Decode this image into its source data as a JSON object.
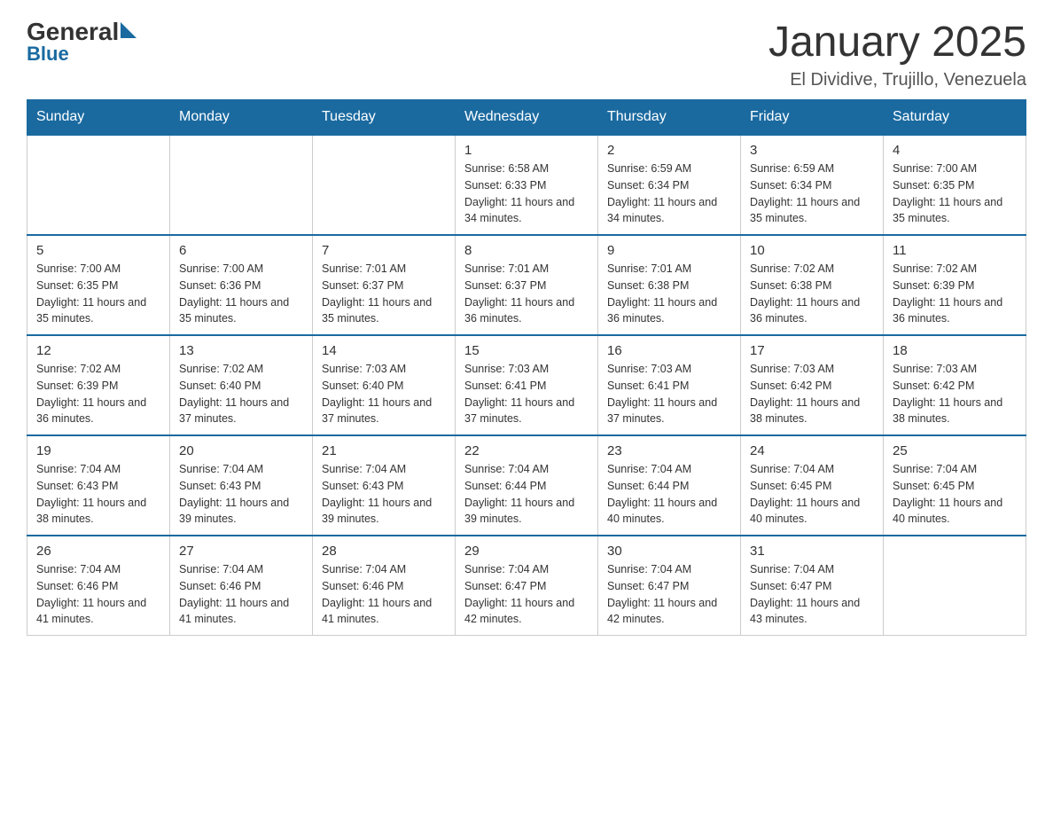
{
  "header": {
    "logo_general": "General",
    "logo_blue": "Blue",
    "month_title": "January 2025",
    "location": "El Dividive, Trujillo, Venezuela"
  },
  "days_of_week": [
    "Sunday",
    "Monday",
    "Tuesday",
    "Wednesday",
    "Thursday",
    "Friday",
    "Saturday"
  ],
  "weeks": [
    [
      {
        "day": "",
        "info": ""
      },
      {
        "day": "",
        "info": ""
      },
      {
        "day": "",
        "info": ""
      },
      {
        "day": "1",
        "info": "Sunrise: 6:58 AM\nSunset: 6:33 PM\nDaylight: 11 hours and 34 minutes."
      },
      {
        "day": "2",
        "info": "Sunrise: 6:59 AM\nSunset: 6:34 PM\nDaylight: 11 hours and 34 minutes."
      },
      {
        "day": "3",
        "info": "Sunrise: 6:59 AM\nSunset: 6:34 PM\nDaylight: 11 hours and 35 minutes."
      },
      {
        "day": "4",
        "info": "Sunrise: 7:00 AM\nSunset: 6:35 PM\nDaylight: 11 hours and 35 minutes."
      }
    ],
    [
      {
        "day": "5",
        "info": "Sunrise: 7:00 AM\nSunset: 6:35 PM\nDaylight: 11 hours and 35 minutes."
      },
      {
        "day": "6",
        "info": "Sunrise: 7:00 AM\nSunset: 6:36 PM\nDaylight: 11 hours and 35 minutes."
      },
      {
        "day": "7",
        "info": "Sunrise: 7:01 AM\nSunset: 6:37 PM\nDaylight: 11 hours and 35 minutes."
      },
      {
        "day": "8",
        "info": "Sunrise: 7:01 AM\nSunset: 6:37 PM\nDaylight: 11 hours and 36 minutes."
      },
      {
        "day": "9",
        "info": "Sunrise: 7:01 AM\nSunset: 6:38 PM\nDaylight: 11 hours and 36 minutes."
      },
      {
        "day": "10",
        "info": "Sunrise: 7:02 AM\nSunset: 6:38 PM\nDaylight: 11 hours and 36 minutes."
      },
      {
        "day": "11",
        "info": "Sunrise: 7:02 AM\nSunset: 6:39 PM\nDaylight: 11 hours and 36 minutes."
      }
    ],
    [
      {
        "day": "12",
        "info": "Sunrise: 7:02 AM\nSunset: 6:39 PM\nDaylight: 11 hours and 36 minutes."
      },
      {
        "day": "13",
        "info": "Sunrise: 7:02 AM\nSunset: 6:40 PM\nDaylight: 11 hours and 37 minutes."
      },
      {
        "day": "14",
        "info": "Sunrise: 7:03 AM\nSunset: 6:40 PM\nDaylight: 11 hours and 37 minutes."
      },
      {
        "day": "15",
        "info": "Sunrise: 7:03 AM\nSunset: 6:41 PM\nDaylight: 11 hours and 37 minutes."
      },
      {
        "day": "16",
        "info": "Sunrise: 7:03 AM\nSunset: 6:41 PM\nDaylight: 11 hours and 37 minutes."
      },
      {
        "day": "17",
        "info": "Sunrise: 7:03 AM\nSunset: 6:42 PM\nDaylight: 11 hours and 38 minutes."
      },
      {
        "day": "18",
        "info": "Sunrise: 7:03 AM\nSunset: 6:42 PM\nDaylight: 11 hours and 38 minutes."
      }
    ],
    [
      {
        "day": "19",
        "info": "Sunrise: 7:04 AM\nSunset: 6:43 PM\nDaylight: 11 hours and 38 minutes."
      },
      {
        "day": "20",
        "info": "Sunrise: 7:04 AM\nSunset: 6:43 PM\nDaylight: 11 hours and 39 minutes."
      },
      {
        "day": "21",
        "info": "Sunrise: 7:04 AM\nSunset: 6:43 PM\nDaylight: 11 hours and 39 minutes."
      },
      {
        "day": "22",
        "info": "Sunrise: 7:04 AM\nSunset: 6:44 PM\nDaylight: 11 hours and 39 minutes."
      },
      {
        "day": "23",
        "info": "Sunrise: 7:04 AM\nSunset: 6:44 PM\nDaylight: 11 hours and 40 minutes."
      },
      {
        "day": "24",
        "info": "Sunrise: 7:04 AM\nSunset: 6:45 PM\nDaylight: 11 hours and 40 minutes."
      },
      {
        "day": "25",
        "info": "Sunrise: 7:04 AM\nSunset: 6:45 PM\nDaylight: 11 hours and 40 minutes."
      }
    ],
    [
      {
        "day": "26",
        "info": "Sunrise: 7:04 AM\nSunset: 6:46 PM\nDaylight: 11 hours and 41 minutes."
      },
      {
        "day": "27",
        "info": "Sunrise: 7:04 AM\nSunset: 6:46 PM\nDaylight: 11 hours and 41 minutes."
      },
      {
        "day": "28",
        "info": "Sunrise: 7:04 AM\nSunset: 6:46 PM\nDaylight: 11 hours and 41 minutes."
      },
      {
        "day": "29",
        "info": "Sunrise: 7:04 AM\nSunset: 6:47 PM\nDaylight: 11 hours and 42 minutes."
      },
      {
        "day": "30",
        "info": "Sunrise: 7:04 AM\nSunset: 6:47 PM\nDaylight: 11 hours and 42 minutes."
      },
      {
        "day": "31",
        "info": "Sunrise: 7:04 AM\nSunset: 6:47 PM\nDaylight: 11 hours and 43 minutes."
      },
      {
        "day": "",
        "info": ""
      }
    ]
  ]
}
